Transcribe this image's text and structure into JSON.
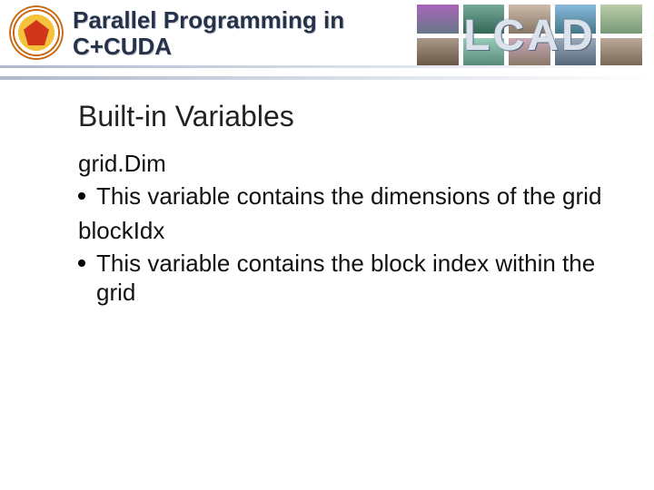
{
  "header": {
    "title_line1": "Parallel Programming in",
    "title_line2": "C+CUDA",
    "lab_mark": "LCAD"
  },
  "content": {
    "section_title": "Built-in Variables",
    "items": [
      {
        "term": "grid.Dim",
        "desc": "This variable contains the dimensions of the grid"
      },
      {
        "term": "blockIdx",
        "desc": "This variable contains the block index within the grid"
      }
    ]
  }
}
